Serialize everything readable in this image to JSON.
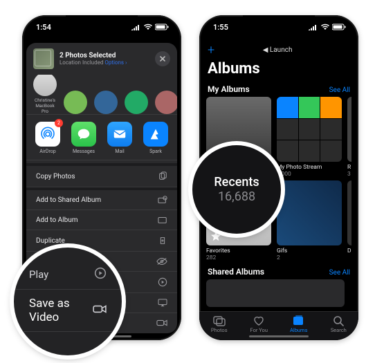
{
  "left": {
    "time": "1:54",
    "share": {
      "title": "2 Photos Selected",
      "subtitle_prefix": "Location Included",
      "subtitle_link": "Options ›",
      "contacts": [
        {
          "label": "Christine's MacBook Pro"
        },
        {
          "label": ""
        },
        {
          "label": ""
        },
        {
          "label": ""
        },
        {
          "label": ""
        }
      ],
      "apps": [
        {
          "label": "AirDrop",
          "kind": "airdrop",
          "badge": "2"
        },
        {
          "label": "Messages",
          "kind": "messages"
        },
        {
          "label": "Mail",
          "kind": "mail"
        },
        {
          "label": "Spark",
          "kind": "spark"
        }
      ],
      "actions": [
        {
          "label": "Copy Photos",
          "icon": "copy"
        },
        {
          "label": "Add to Shared Album",
          "icon": "shared-album"
        },
        {
          "label": "Add to Album",
          "icon": "album"
        },
        {
          "label": "Duplicate",
          "icon": "duplicate"
        },
        {
          "label": "Hide",
          "icon": "hide"
        },
        {
          "label": "Slideshow",
          "icon": "play"
        },
        {
          "label": "AirPlay",
          "icon": "airplay"
        },
        {
          "label": "Save as Video",
          "icon": "video"
        }
      ]
    },
    "lens": {
      "row1": "Play",
      "row2": "Save as Video"
    }
  },
  "right": {
    "time": "1:55",
    "nav_back": "◀ Launch",
    "title": "Albums",
    "sections": {
      "my": {
        "header": "My Albums",
        "see_all": "See All"
      },
      "shared": {
        "header": "Shared Albums",
        "see_all": "See All"
      }
    },
    "my_albums": [
      {
        "name": "Recents",
        "count": "16,688"
      },
      {
        "name": "My Photo Stream",
        "count": "1,000"
      },
      {
        "name": "R",
        "count": "3"
      },
      {
        "name": "Favorites",
        "count": "282"
      },
      {
        "name": "Gifs",
        "count": "2"
      },
      {
        "name": "D",
        "count": ""
      }
    ],
    "tabs": [
      {
        "label": "Photos"
      },
      {
        "label": "For You"
      },
      {
        "label": "Albums"
      },
      {
        "label": "Search"
      }
    ],
    "lens": {
      "title": "Recents",
      "count": "16,688"
    }
  }
}
